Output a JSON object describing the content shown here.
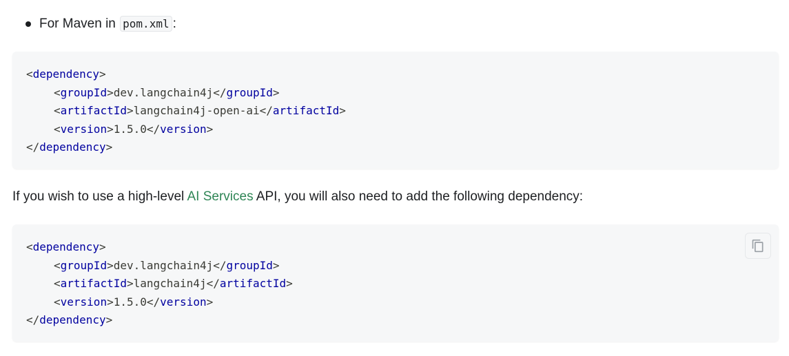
{
  "bullet": {
    "prefix": "For Maven in ",
    "code": "pom.xml",
    "suffix": ":"
  },
  "code_block_1": {
    "lines": [
      {
        "indent": false,
        "open": "dependency",
        "content": "",
        "close": ""
      },
      {
        "indent": true,
        "open": "groupId",
        "content": "dev.langchain4j",
        "close": "groupId"
      },
      {
        "indent": true,
        "open": "artifactId",
        "content": "langchain4j-open-ai",
        "close": "artifactId"
      },
      {
        "indent": true,
        "open": "version",
        "content": "1.5.0",
        "close": "version"
      },
      {
        "indent": false,
        "open": "",
        "content": "",
        "close": "dependency"
      }
    ]
  },
  "paragraph": {
    "before": "If you wish to use a high-level ",
    "link": "AI Services",
    "after": " API, you will also need to add the following dependency:"
  },
  "code_block_2": {
    "lines": [
      {
        "indent": false,
        "open": "dependency",
        "content": "",
        "close": ""
      },
      {
        "indent": true,
        "open": "groupId",
        "content": "dev.langchain4j",
        "close": "groupId"
      },
      {
        "indent": true,
        "open": "artifactId",
        "content": "langchain4j",
        "close": "artifactId"
      },
      {
        "indent": true,
        "open": "version",
        "content": "1.5.0",
        "close": "version"
      },
      {
        "indent": false,
        "open": "",
        "content": "",
        "close": "dependency"
      }
    ],
    "copy_icon": "copy-icon"
  },
  "colors": {
    "tag": "#00009f",
    "link": "#2e8555",
    "code_bg": "#f6f7f8"
  }
}
